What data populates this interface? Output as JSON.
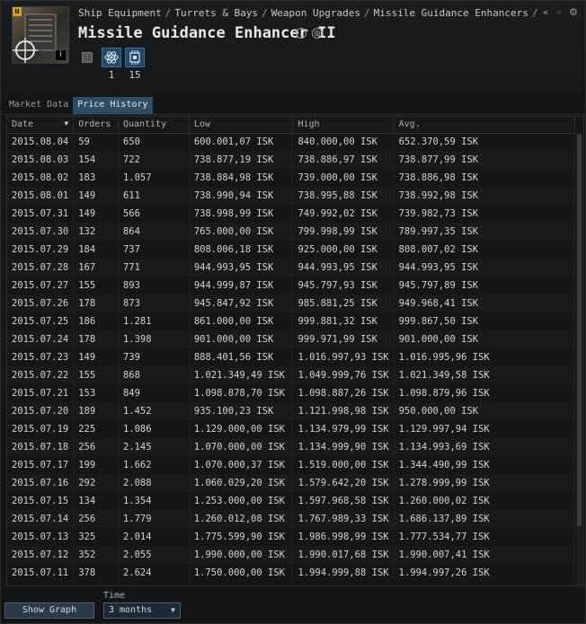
{
  "header": {
    "breadcrumb": [
      "Ship Equipment",
      "Turrets & Bays",
      "Weapon Upgrades",
      "Missile Guidance Enhancers"
    ],
    "breadcrumb_sep": "/",
    "title": "Missile Guidance Enhancer II",
    "tech_level": "II",
    "attributes": [
      {
        "icon": "atom-icon",
        "value": "1"
      },
      {
        "icon": "cpu-icon",
        "value": "15"
      }
    ]
  },
  "tabs": [
    {
      "label": "Market Data",
      "active": false
    },
    {
      "label": "Price History",
      "active": true
    }
  ],
  "table": {
    "columns": [
      "Date",
      "Orders",
      "Quantity",
      "Low",
      "High",
      "Avg."
    ],
    "rows": [
      [
        "2015.08.04",
        "59",
        "650",
        "600.001,07 ISK",
        "840.000,00 ISK",
        "652.370,59 ISK"
      ],
      [
        "2015.08.03",
        "154",
        "722",
        "738.877,19 ISK",
        "738.886,97 ISK",
        "738.877,99 ISK"
      ],
      [
        "2015.08.02",
        "183",
        "1.057",
        "738.884,98 ISK",
        "739.000,00 ISK",
        "738.886,98 ISK"
      ],
      [
        "2015.08.01",
        "149",
        "611",
        "738.990,94 ISK",
        "738.995,88 ISK",
        "738.992,98 ISK"
      ],
      [
        "2015.07.31",
        "149",
        "566",
        "738.998,99 ISK",
        "749.992,02 ISK",
        "739.982,73 ISK"
      ],
      [
        "2015.07.30",
        "132",
        "864",
        "765.000,00 ISK",
        "799.998,99 ISK",
        "789.997,35 ISK"
      ],
      [
        "2015.07.29",
        "184",
        "737",
        "808.006,18 ISK",
        "925.000,00 ISK",
        "808.007,02 ISK"
      ],
      [
        "2015.07.28",
        "167",
        "771",
        "944.993,95 ISK",
        "944.993,95 ISK",
        "944.993,95 ISK"
      ],
      [
        "2015.07.27",
        "155",
        "893",
        "944.999,87 ISK",
        "945.797,93 ISK",
        "945.797,89 ISK"
      ],
      [
        "2015.07.26",
        "178",
        "873",
        "945.847,92 ISK",
        "985.881,25 ISK",
        "949.968,41 ISK"
      ],
      [
        "2015.07.25",
        "186",
        "1.281",
        "861.000,00 ISK",
        "999.881,32 ISK",
        "999.867,50 ISK"
      ],
      [
        "2015.07.24",
        "178",
        "1.398",
        "901.000,00 ISK",
        "999.971,99 ISK",
        "901.000,00 ISK"
      ],
      [
        "2015.07.23",
        "149",
        "739",
        "888.401,56 ISK",
        "1.016.997,93 ISK",
        "1.016.995,96 ISK"
      ],
      [
        "2015.07.22",
        "155",
        "868",
        "1.021.349,49 ISK",
        "1.049.999,76 ISK",
        "1.021.349,58 ISK"
      ],
      [
        "2015.07.21",
        "153",
        "849",
        "1.098.878,70 ISK",
        "1.098.887,26 ISK",
        "1.098.879,96 ISK"
      ],
      [
        "2015.07.20",
        "189",
        "1.452",
        "935.100,23 ISK",
        "1.121.998,98 ISK",
        "950.000,00 ISK"
      ],
      [
        "2015.07.19",
        "225",
        "1.086",
        "1.129.000,00 ISK",
        "1.134.979,99 ISK",
        "1.129.997,94 ISK"
      ],
      [
        "2015.07.18",
        "256",
        "2.145",
        "1.070.000,00 ISK",
        "1.134.999,90 ISK",
        "1.134.993,69 ISK"
      ],
      [
        "2015.07.17",
        "199",
        "1.662",
        "1.070.000,37 ISK",
        "1.519.000,00 ISK",
        "1.344.490,99 ISK"
      ],
      [
        "2015.07.16",
        "292",
        "2.088",
        "1.060.029,20 ISK",
        "1.579.642,20 ISK",
        "1.278.999,99 ISK"
      ],
      [
        "2015.07.15",
        "134",
        "1.354",
        "1.253.000,00 ISK",
        "1.597.968,58 ISK",
        "1.260.000,02 ISK"
      ],
      [
        "2015.07.14",
        "256",
        "1.779",
        "1.260.012,08 ISK",
        "1.767.989,33 ISK",
        "1.686.137,89 ISK"
      ],
      [
        "2015.07.13",
        "325",
        "2.014",
        "1.775.599,90 ISK",
        "1.986.998,99 ISK",
        "1.777.534,77 ISK"
      ],
      [
        "2015.07.12",
        "352",
        "2.055",
        "1.990.000,00 ISK",
        "1.990.017,68 ISK",
        "1.990.007,41 ISK"
      ],
      [
        "2015.07.11",
        "378",
        "2.624",
        "1.750.000,00 ISK",
        "1.994.999,88 ISK",
        "1.994.997,26 ISK"
      ]
    ]
  },
  "footer": {
    "show_graph_label": "Show Graph",
    "time_label": "Time",
    "time_value": "3 months"
  },
  "colors": {
    "active_tab": "#2d4d66",
    "attribute_bg": "#24486a"
  }
}
